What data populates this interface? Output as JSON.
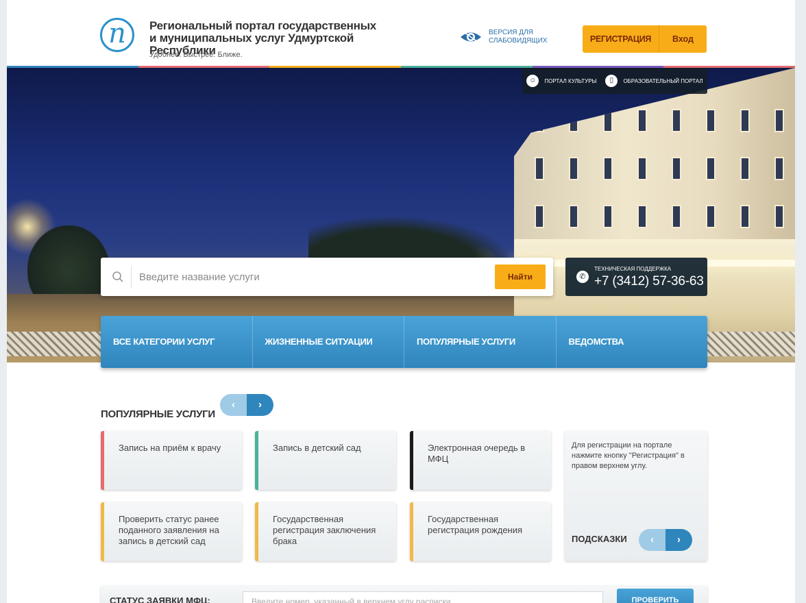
{
  "header": {
    "logo_letter": "n",
    "title_line1": "Региональный портал государственных",
    "title_line2": "и муниципальных услуг Удмуртской Республики",
    "slogan": "Удобнее. Быстрее. Ближе.",
    "accessibility_line1": "Версия для",
    "accessibility_line2": "слабовидящих",
    "register_label": "Регистрация",
    "login_label": "Вход",
    "stripe_colors": [
      "#2f86bd",
      "#e56b6f",
      "#f8ad18",
      "#4bb29a",
      "#7a5bbf",
      "#e56b6f"
    ]
  },
  "hero": {
    "portal_links": [
      {
        "label": "Портал культуры",
        "icon": "theater-mask-icon"
      },
      {
        "label": "Образовательный портал",
        "icon": "book-icon"
      }
    ],
    "search": {
      "placeholder": "Введите название услуги",
      "button_label": "Найти"
    },
    "support": {
      "label": "Техническая поддержка",
      "phone": "+7 (3412) 57-36-63"
    }
  },
  "categories": [
    "Все категории услуг",
    "Жизненные ситуации",
    "Популярные услуги",
    "Ведомства"
  ],
  "popular": {
    "title": "Популярные услуги",
    "prev": "‹",
    "next": "›",
    "cards": [
      {
        "label": "Запись на приём к врачу",
        "accent": "#e56b6f"
      },
      {
        "label": "Запись в детский сад",
        "accent": "#4bb29a"
      },
      {
        "label": "Электронная очередь в МФЦ",
        "accent": "#1a1a1a"
      },
      {
        "label": "Проверить статус ранее поданного заявления на запись в детский сад",
        "accent": "#f0b94a"
      },
      {
        "label": "Государственная регистрация заключения брака",
        "accent": "#f0b94a"
      },
      {
        "label": "Государственная регистрация рождения",
        "accent": "#f0b94a"
      }
    ]
  },
  "hints": {
    "text": "Для регистрации на портале нажмите кнопку \"Регистрация\" в правом верхнем углу.",
    "title": "Подсказки",
    "prev": "‹",
    "next": "›"
  },
  "mfc_status": {
    "label": "Статус заявки МФЦ:",
    "placeholder": "Введите номер, указанный в верхнем углу расписки",
    "button_label": "Проверить"
  }
}
